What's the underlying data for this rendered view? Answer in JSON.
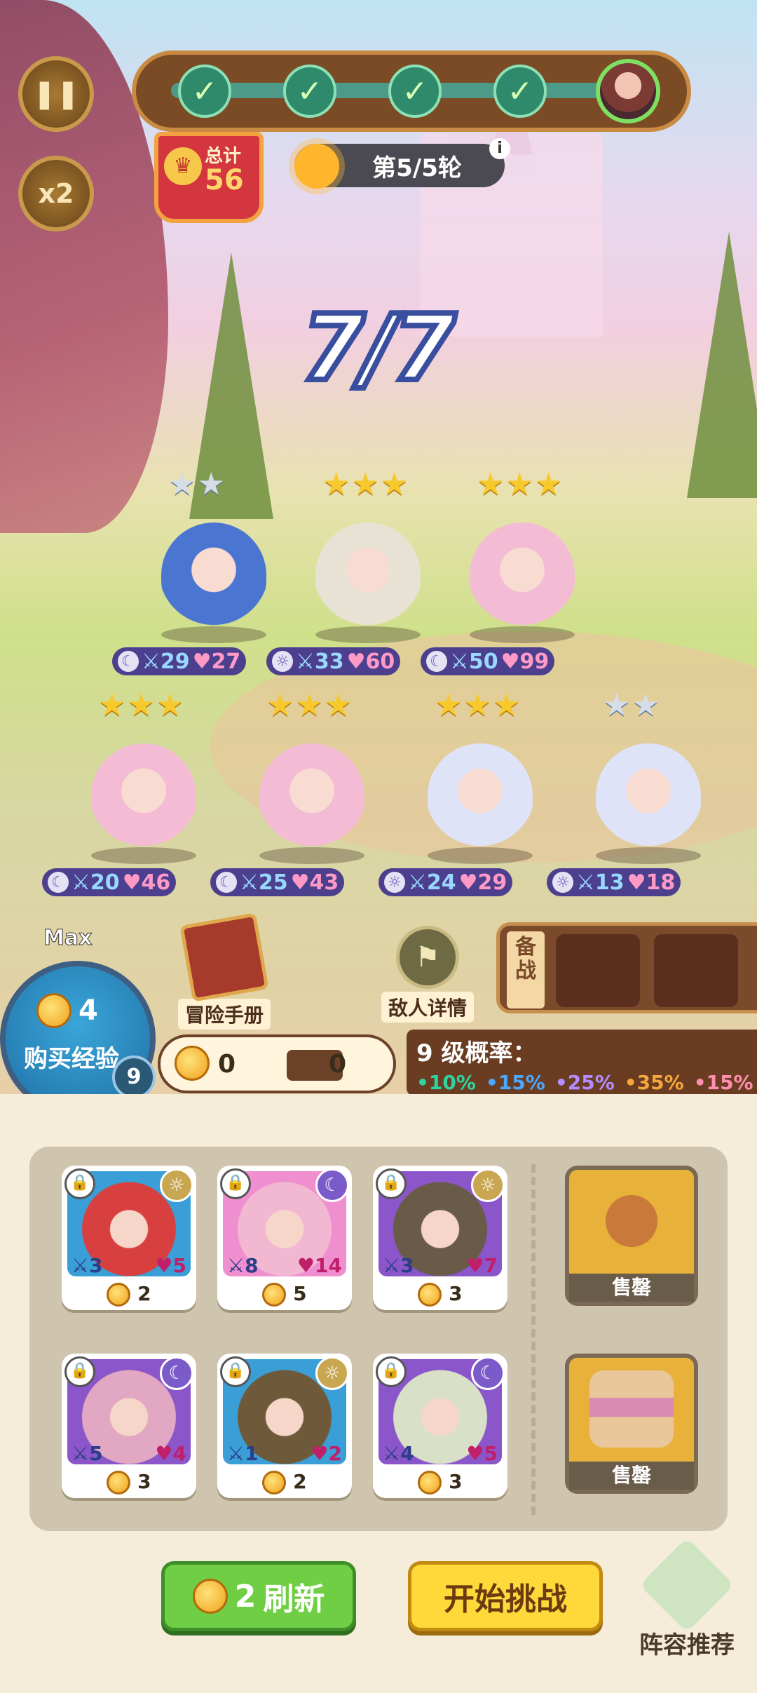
{
  "top": {
    "pause_icon": "pause-icon",
    "speed_label": "x2",
    "progress": {
      "completed_stages": 5,
      "boss_icon": "boss-portrait"
    },
    "total": {
      "label": "总计",
      "value": "56"
    },
    "round": {
      "label": "第5/5轮",
      "info_icon": "info-icon"
    },
    "team_count": "7/7"
  },
  "board": {
    "units": [
      {
        "stars": "★★",
        "rank": "silver",
        "attack": "29",
        "hp": "27",
        "element": "moon"
      },
      {
        "stars": "★★★",
        "rank": "gold",
        "attack": "33",
        "hp": "60",
        "element": "sun"
      },
      {
        "stars": "★★★",
        "rank": "gold",
        "attack": "50",
        "hp": "99",
        "element": "moon"
      },
      {
        "stars": "★★★",
        "rank": "gold",
        "attack": "20",
        "hp": "46",
        "element": "moon"
      },
      {
        "stars": "★★★",
        "rank": "gold",
        "attack": "25",
        "hp": "43",
        "element": "moon"
      },
      {
        "stars": "★★★",
        "rank": "gold",
        "attack": "24",
        "hp": "29",
        "element": "sun"
      },
      {
        "stars": "★★",
        "rank": "silver",
        "attack": "13",
        "hp": "18",
        "element": "sun"
      }
    ]
  },
  "economy": {
    "exp_max_label": "Max",
    "exp_cost": "4",
    "buy_exp_label": "购买经验",
    "level": "9",
    "gold": "0",
    "interest": "0",
    "adventure_book_label": "冒险手册",
    "enemy_details_label": "敌人详情",
    "bench_label": "备战",
    "odds_title": "9 级概率：",
    "odds": [
      {
        "value": "•10%",
        "color": "#2fd3a0"
      },
      {
        "value": "•15%",
        "color": "#4aa8ff"
      },
      {
        "value": "•25%",
        "color": "#b58cff"
      },
      {
        "value": "•35%",
        "color": "#f5a73b"
      },
      {
        "value": "•15%",
        "color": "#ff8fb0"
      }
    ]
  },
  "shop": {
    "cards": [
      {
        "attack": "3",
        "hp": "5",
        "cost": "2",
        "element": "sun",
        "art": "#d84040",
        "bg": "#3a9fd6"
      },
      {
        "attack": "8",
        "hp": "14",
        "cost": "5",
        "element": "moon",
        "art": "#f2b8d2",
        "bg": "#f08fcf"
      },
      {
        "attack": "3",
        "hp": "7",
        "cost": "3",
        "element": "sun",
        "art": "#6a5a48",
        "bg": "#8a56c9"
      },
      {
        "attack": "5",
        "hp": "4",
        "cost": "3",
        "element": "moon",
        "art": "#e2a7c2",
        "bg": "#8a56c9"
      },
      {
        "attack": "1",
        "hp": "2",
        "cost": "2",
        "element": "sun",
        "art": "#6e5a3a",
        "bg": "#3a9fd6"
      },
      {
        "attack": "4",
        "hp": "5",
        "cost": "3",
        "element": "moon",
        "art": "#d8e0c8",
        "bg": "#8a56c9"
      }
    ],
    "items": [
      {
        "label": "售罄",
        "icon": "gingerbread-icon"
      },
      {
        "label": "售罄",
        "icon": "sandwich-icon"
      }
    ],
    "refresh_cost": "2",
    "refresh_label": "刷新",
    "start_label": "开始挑战",
    "recommend_label": "阵容推荐"
  }
}
